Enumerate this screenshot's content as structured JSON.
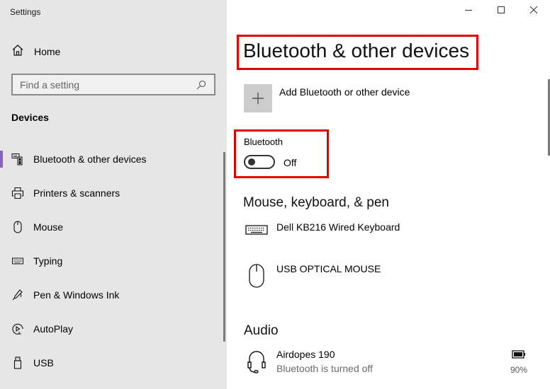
{
  "window": {
    "app_title": "Settings",
    "controls": {
      "minimize": "minimize-icon",
      "maximize": "maximize-icon",
      "close": "close-icon"
    }
  },
  "sidebar": {
    "home": {
      "label": "Home",
      "icon": "home-icon"
    },
    "search": {
      "placeholder": "Find a setting",
      "value": "",
      "icon": "search-icon"
    },
    "section_label": "Devices",
    "items": [
      {
        "label": "Bluetooth & other devices",
        "icon": "bluetooth-devices-icon",
        "selected": true
      },
      {
        "label": "Printers & scanners",
        "icon": "printer-icon",
        "selected": false
      },
      {
        "label": "Mouse",
        "icon": "mouse-icon",
        "selected": false
      },
      {
        "label": "Typing",
        "icon": "keyboard-icon",
        "selected": false
      },
      {
        "label": "Pen & Windows Ink",
        "icon": "pen-icon",
        "selected": false
      },
      {
        "label": "AutoPlay",
        "icon": "autoplay-icon",
        "selected": false
      },
      {
        "label": "USB",
        "icon": "usb-icon",
        "selected": false
      }
    ],
    "accent_color": "#8764b8"
  },
  "main": {
    "title": "Bluetooth & other devices",
    "add_device": {
      "label": "Add Bluetooth or other device",
      "icon": "plus-icon"
    },
    "bluetooth": {
      "label": "Bluetooth",
      "state": "Off",
      "enabled": false
    },
    "sections": [
      {
        "heading": "Mouse, keyboard, & pen",
        "devices": [
          {
            "name": "Dell KB216 Wired Keyboard",
            "icon": "keyboard-icon"
          },
          {
            "name": "USB OPTICAL MOUSE",
            "icon": "mouse-icon"
          }
        ]
      },
      {
        "heading": "Audio",
        "devices": [
          {
            "name": "Airdopes 190",
            "status": "Bluetooth is turned off",
            "icon": "headset-icon",
            "battery": "90%"
          }
        ]
      }
    ],
    "highlight_color": "#e00000"
  }
}
